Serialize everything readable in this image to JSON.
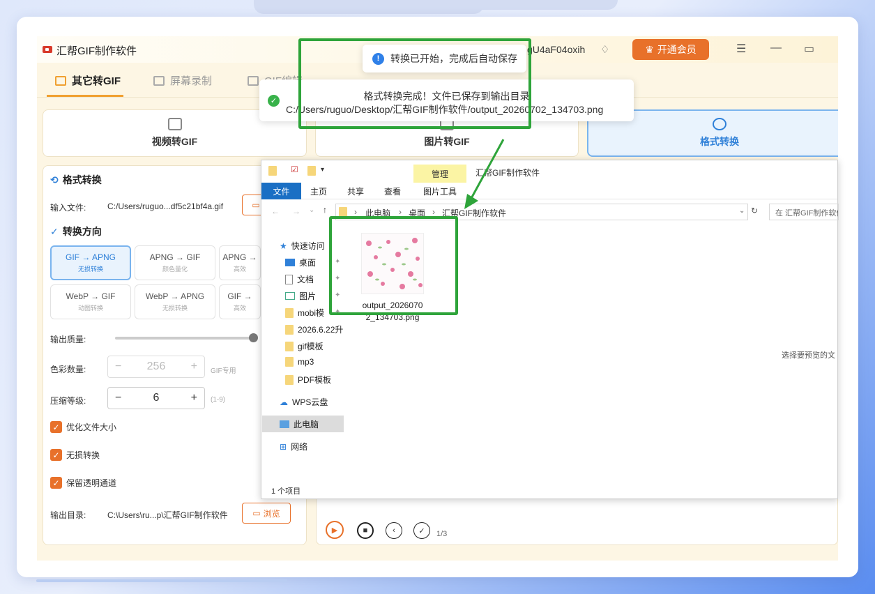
{
  "app": {
    "title": "汇帮GIF制作软件",
    "user": "gU4aF04oxih",
    "vip_label": "开通会员"
  },
  "tabs": [
    {
      "label": "其它转GIF"
    },
    {
      "label": "屏幕录制"
    },
    {
      "label": "GIF编辑"
    }
  ],
  "modes": [
    {
      "label": "视频转GIF"
    },
    {
      "label": "图片转GIF"
    },
    {
      "label": "格式转换"
    }
  ],
  "panel": {
    "title": "格式转换",
    "input_label": "输入文件:",
    "input_value": "C:/Users/ruguo...df5c21bf4a.gif",
    "direction_title": "转换方向",
    "conversions": [
      {
        "main": "GIF → APNG",
        "sub": "无损转换"
      },
      {
        "main": "APNG → GIF",
        "sub": "颜色量化"
      },
      {
        "main": "APNG →",
        "sub": "高效"
      },
      {
        "main": "WebP → GIF",
        "sub": "动图转换"
      },
      {
        "main": "WebP → APNG",
        "sub": "无损转换"
      },
      {
        "main": "GIF →",
        "sub": "高效"
      }
    ],
    "quality_label": "输出质量:",
    "quality_value": 0.82,
    "colors_label": "色彩数量:",
    "colors_value": "256",
    "colors_note": "GIF专用",
    "compress_label": "压缩等级:",
    "compress_value": "6",
    "compress_note": "(1-9)",
    "checkboxes": [
      {
        "label": "优化文件大小"
      },
      {
        "label": "无损转换"
      },
      {
        "label": "保留透明通道"
      }
    ],
    "output_label": "输出目录:",
    "output_value": "C:\\Users\\ru...p\\汇帮GIF制作软件",
    "browse_label": "浏览"
  },
  "player": {
    "page": "1/3"
  },
  "toast_start": "转换已开始，完成后自动保存",
  "toast_done": {
    "line1": "格式转换完成！文件已保存到输出目录",
    "line2": "C:/Users/ruguo/Desktop/汇帮GIF制作软件/output_20260702_134703.png"
  },
  "explorer": {
    "window_title": "汇帮GIF制作软件",
    "manage": "管理",
    "ribbon": [
      "文件",
      "主页",
      "共享",
      "查看",
      "图片工具"
    ],
    "path": [
      "此电脑",
      "桌面",
      "汇帮GIF制作软件"
    ],
    "search_placeholder": "在 汇帮GIF制作软件",
    "nav": [
      {
        "label": "快速访问",
        "icon": "star-icon"
      },
      {
        "label": "桌面",
        "icon": "desktop-icon"
      },
      {
        "label": "文档",
        "icon": "document-icon"
      },
      {
        "label": "图片",
        "icon": "picture-icon"
      },
      {
        "label": "mobi模",
        "icon": "folder-icon"
      },
      {
        "label": "2026.6.22升",
        "icon": "folder-icon"
      },
      {
        "label": "gif模板",
        "icon": "folder-icon"
      },
      {
        "label": "mp3",
        "icon": "folder-icon"
      },
      {
        "label": "PDF模板",
        "icon": "folder-icon"
      },
      {
        "label": "WPS云盘",
        "icon": "cloud-icon"
      },
      {
        "label": "此电脑",
        "icon": "computer-icon"
      },
      {
        "label": "网络",
        "icon": "network-icon"
      }
    ],
    "file_name_line1": "output_2026070",
    "file_name_line2": "2_134703.png",
    "preview_hint": "选择要预览的文",
    "status": "1 个项目"
  },
  "colors": {
    "accent": "#e8712a",
    "blue": "#2f80d8",
    "highlight": "#2ea43a"
  }
}
